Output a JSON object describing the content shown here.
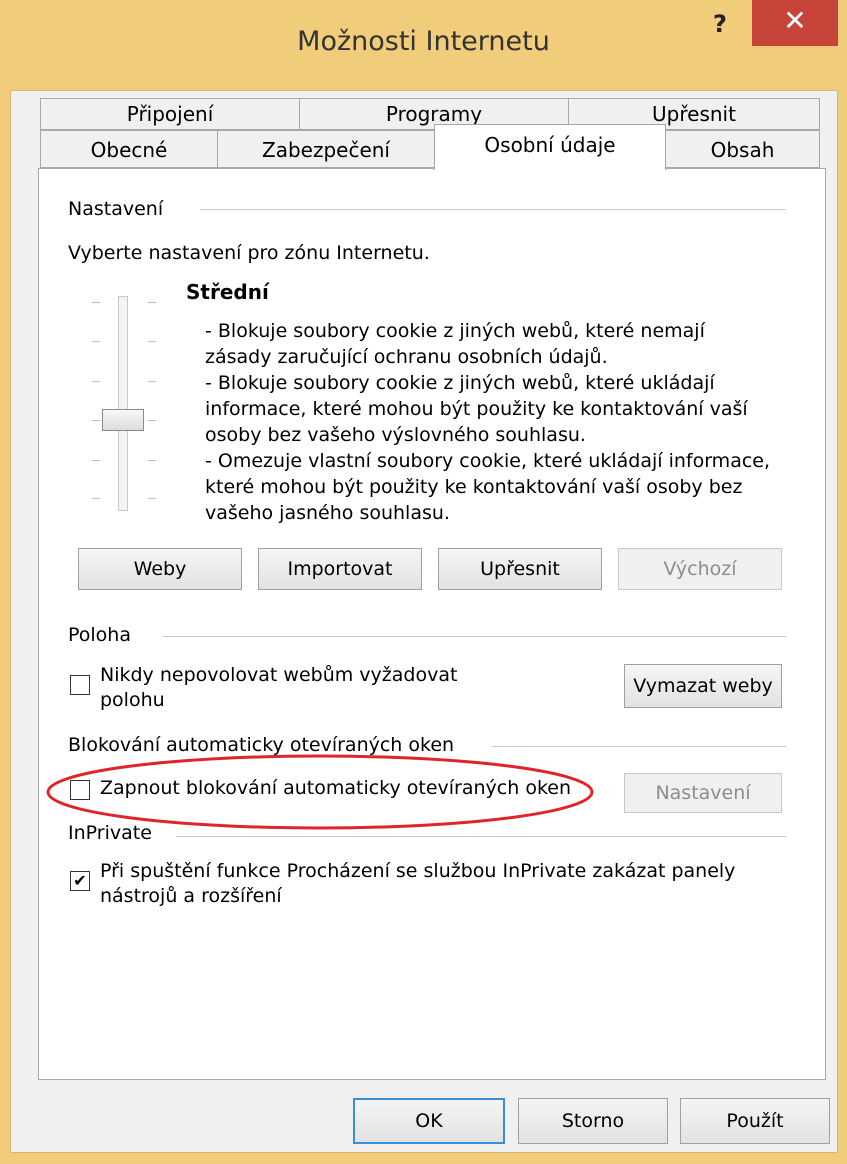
{
  "window": {
    "title": "Možnosti Internetu",
    "help_label": "?",
    "close_label": "✕"
  },
  "tabs_row1": [
    {
      "label": "Připojení"
    },
    {
      "label": "Programy"
    },
    {
      "label": "Upřesnit"
    }
  ],
  "tabs_row2": [
    {
      "label": "Obecné"
    },
    {
      "label": "Zabezpečení"
    },
    {
      "label": "Osobní údaje",
      "active": true
    },
    {
      "label": "Obsah"
    }
  ],
  "settings": {
    "group_label": "Nastavení",
    "zone_text": "Vyberte nastavení pro zónu Internetu.",
    "level_name": "Střední",
    "level_description": [
      "- Blokuje soubory cookie z jiných webů, které nemají",
      "zásady zaručující ochranu osobních údajů.",
      "- Blokuje soubory cookie z jiných webů, které ukládají",
      "informace, které mohou být použity ke kontaktování vaší",
      "osoby bez vašeho výslovného souhlasu.",
      "- Omezuje vlastní soubory cookie, které ukládají informace,",
      "které mohou být použity ke kontaktování vaší osoby bez",
      "vašeho jasného souhlasu."
    ],
    "buttons": {
      "sites": "Weby",
      "import": "Importovat",
      "advanced": "Upřesnit",
      "default": "Výchozí"
    }
  },
  "location": {
    "group_label": "Poloha",
    "never_allow_line1": "Nikdy nepovolovat webům vyžadovat",
    "never_allow_line2": "polohu",
    "never_allow_checked": false,
    "clear_sites": "Vymazat weby"
  },
  "popup": {
    "group_label": "Blokování automaticky otevíraných oken",
    "enable_label": "Zapnout blokování automaticky otevíraných oken",
    "enable_checked": false,
    "settings_button": "Nastavení",
    "highlight_color": "#e0242a"
  },
  "inprivate": {
    "group_label": "InPrivate",
    "disable_line1": "Při spuštění funkce Procházení se službou InPrivate zakázat panely",
    "disable_line2": "nástrojů a rozšíření",
    "disable_checked": true,
    "check_mark": "✔"
  },
  "footer": {
    "ok": "OK",
    "cancel": "Storno",
    "apply": "Použít"
  }
}
